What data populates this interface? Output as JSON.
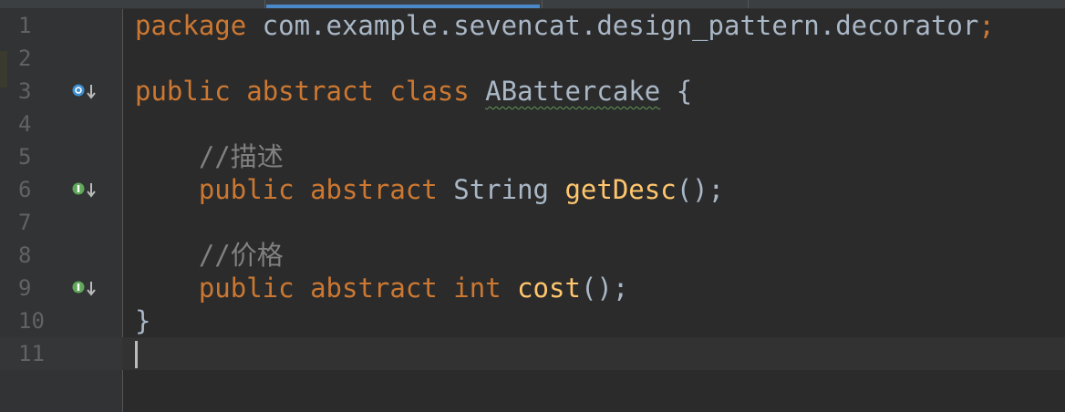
{
  "editor": {
    "colors": {
      "background": "#2b2b2b",
      "gutter": "#313335",
      "keyword": "#cc7832",
      "function": "#ffc66d",
      "comment": "#808080",
      "text": "#a9b7c6",
      "line_number": "#606366"
    },
    "lines": [
      {
        "number": "1",
        "kw": "package",
        "text": " com.example.sevencat.design_pattern.decorator",
        "punct": ";"
      },
      {
        "number": "2"
      },
      {
        "number": "3",
        "marker": "implemented-overridden-icon",
        "kw1": "public",
        "kw2": "abstract",
        "kw3": "class",
        "class_name": "ABattercake",
        "brace": "{"
      },
      {
        "number": "4"
      },
      {
        "number": "5",
        "comment": "//描述"
      },
      {
        "number": "6",
        "marker": "implemented-method-icon",
        "kw1": "public",
        "kw2": "abstract",
        "type": "String",
        "method": "getDesc",
        "tail": "();"
      },
      {
        "number": "7"
      },
      {
        "number": "8",
        "comment": "//价格"
      },
      {
        "number": "9",
        "marker": "implemented-method-icon",
        "kw1": "public",
        "kw2": "abstract",
        "type": "int",
        "method": "cost",
        "tail": "();"
      },
      {
        "number": "10",
        "brace": "}"
      },
      {
        "number": "11"
      }
    ]
  }
}
